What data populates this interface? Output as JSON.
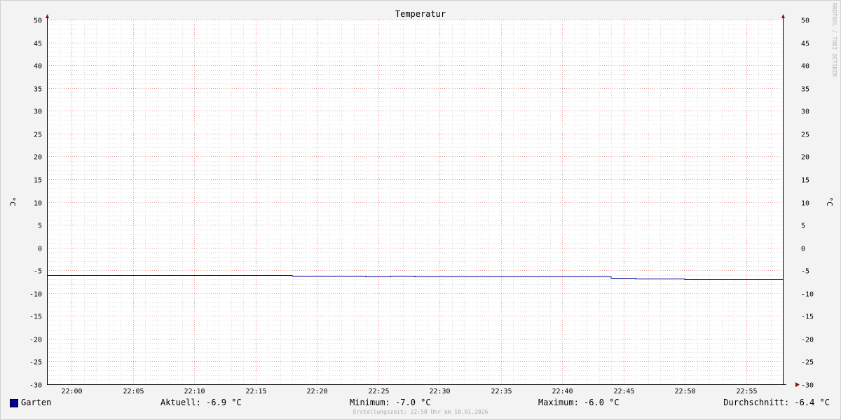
{
  "chart_data": {
    "type": "line",
    "title": "Temperatur",
    "ylabel": "°C",
    "ylabel_right": "°C",
    "ylim": [
      -30,
      50
    ],
    "yticks": [
      50,
      45,
      40,
      35,
      30,
      25,
      20,
      15,
      10,
      5,
      0,
      -5,
      -10,
      -15,
      -20,
      -25,
      -30
    ],
    "xlim": [
      "21:58",
      "22:58"
    ],
    "xticks": [
      "22:00",
      "22:05",
      "22:10",
      "22:15",
      "22:20",
      "22:25",
      "22:30",
      "22:35",
      "22:40",
      "22:45",
      "22:50",
      "22:55"
    ],
    "grid": true,
    "legend_placement": "bottom",
    "series": [
      {
        "name": "Garten",
        "color": "#000099",
        "x": [
          "21:58",
          "22:18",
          "22:18",
          "22:24",
          "22:24",
          "22:26",
          "22:26",
          "22:28",
          "22:28",
          "22:40",
          "22:40",
          "22:44",
          "22:44",
          "22:46",
          "22:46",
          "22:50",
          "22:50",
          "22:58"
        ],
        "values": [
          -6.0,
          -6.0,
          -6.2,
          -6.2,
          -6.3,
          -6.3,
          -6.2,
          -6.2,
          -6.3,
          -6.3,
          -6.4,
          -6.4,
          -6.6,
          -6.6,
          -6.8,
          -6.8,
          -6.9,
          -6.9
        ]
      }
    ]
  },
  "legend": {
    "series_name": "Garten",
    "swatch_color": "#000099",
    "current": "Aktuell: -6.9 °C",
    "minimum": "Minimum: -7.0 °C",
    "maximum": "Maximum: -6.0 °C",
    "average": "Durchschnitt: -6.4 °C"
  },
  "footer": "Erstellungszeit: 22:58 Uhr am 10.01.2026",
  "watermark": "RRDTOOL / TOBI OETIKER"
}
